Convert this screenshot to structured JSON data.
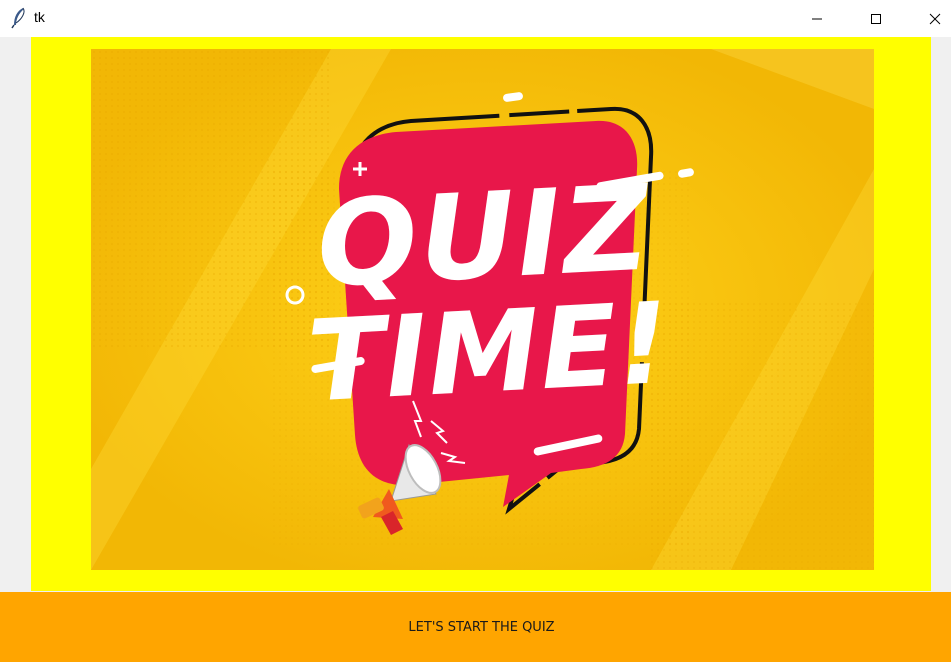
{
  "window": {
    "title": "tk",
    "icon": "feather-icon",
    "controls": [
      "minimize-icon",
      "maximize-icon",
      "close-icon"
    ]
  },
  "content": {
    "background_color": "#ffff00",
    "image": {
      "description_icon": "megaphone-icon",
      "line1": "QUIZ",
      "line2": "TIME!",
      "background_color": "#f7c80b",
      "bubble_color": "#e8174a"
    }
  },
  "start_button": {
    "label": "LET'S START THE QUIZ",
    "color": "#ffa500"
  }
}
